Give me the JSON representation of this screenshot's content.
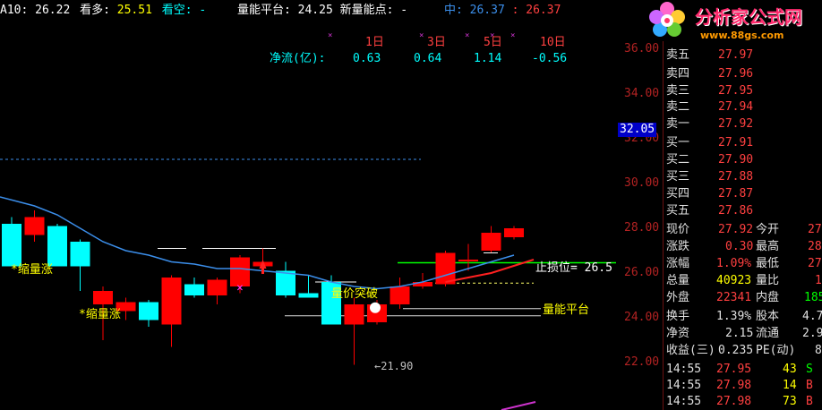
{
  "header": {
    "a10_label": "A10:",
    "a10_value": "26.22",
    "bull_label": "看多:",
    "bull_value": "25.51",
    "bear_label": "看空:",
    "bear_value": "-",
    "vol_platform_label": "量能平台:",
    "vol_platform_value": "24.25",
    "new_vol_label": "新量能点:",
    "new_vol_value": "-",
    "mid_label": "中:",
    "mid_value": "26.37",
    "mid_sep": ":",
    "mid_value2": "26.37"
  },
  "netflow": {
    "label": "净流(亿):",
    "periods": [
      "1日",
      "3日",
      "5日",
      "10日"
    ],
    "values": [
      "0.63",
      "0.64",
      "1.14",
      "-0.56"
    ],
    "marks": [
      "×",
      "×",
      "×",
      "×",
      "×"
    ]
  },
  "logo": {
    "name": "分析家公式网",
    "url": "www.88gs.com"
  },
  "annotations": {
    "shrink_up_1": "*缩量涨",
    "shrink_up_2": "*缩量涨",
    "vol_breakout": "量价突破",
    "stop_loss": "止损位= 26.5",
    "vol_platform": "量能平台",
    "low_price": "←21.90"
  },
  "axis": {
    "ticks": [
      "36.00",
      "34.00",
      "32.00",
      "30.00",
      "28.00",
      "26.00",
      "24.00",
      "22.00"
    ],
    "price_marker": "32.05"
  },
  "chart_data": {
    "type": "candlestick",
    "ylim": [
      21.0,
      37.1
    ],
    "y_ticks": [
      36,
      34,
      32,
      30,
      28,
      26,
      24,
      22
    ],
    "candles": [
      {
        "o": 28.2,
        "h": 28.5,
        "l": 26.3,
        "c": 26.3
      },
      {
        "o": 27.7,
        "h": 28.8,
        "l": 27.4,
        "c": 28.5
      },
      {
        "o": 28.1,
        "h": 28.2,
        "l": 26.3,
        "c": 26.3
      },
      {
        "o": 27.4,
        "h": 27.5,
        "l": 25.2,
        "c": 26.3
      },
      {
        "o": 24.6,
        "h": 25.4,
        "l": 23.0,
        "c": 25.2
      },
      {
        "o": 24.3,
        "h": 24.9,
        "l": 23.9,
        "c": 24.7
      },
      {
        "o": 24.7,
        "h": 24.8,
        "l": 23.6,
        "c": 23.9
      },
      {
        "o": 23.7,
        "h": 25.9,
        "l": 22.7,
        "c": 25.8
      },
      {
        "o": 25.5,
        "h": 25.8,
        "l": 24.9,
        "c": 25.0
      },
      {
        "o": 25.0,
        "h": 25.8,
        "l": 24.6,
        "c": 25.7
      },
      {
        "o": 25.4,
        "h": 26.8,
        "l": 25.1,
        "c": 26.7
      },
      {
        "o": 26.3,
        "h": 27.1,
        "l": 26.1,
        "c": 26.5
      },
      {
        "o": 26.1,
        "h": 26.5,
        "l": 24.9,
        "c": 25.0
      },
      {
        "o": 25.1,
        "h": 25.9,
        "l": 24.9,
        "c": 24.9
      },
      {
        "o": 25.6,
        "h": 25.9,
        "l": 23.7,
        "c": 23.7
      },
      {
        "o": 23.7,
        "h": 24.9,
        "l": 21.9,
        "c": 24.6
      },
      {
        "o": 23.8,
        "h": 24.8,
        "l": 23.7,
        "c": 24.6
      },
      {
        "o": 24.6,
        "h": 25.8,
        "l": 24.4,
        "c": 25.4
      },
      {
        "o": 25.4,
        "h": 26.0,
        "l": 25.3,
        "c": 25.6
      },
      {
        "o": 25.5,
        "h": 27.0,
        "l": 25.4,
        "c": 26.9
      },
      {
        "o": 26.6,
        "h": 27.3,
        "l": 26.1,
        "c": 26.6
      },
      {
        "o": 27.0,
        "h": 28.1,
        "l": 26.9,
        "c": 27.8
      },
      {
        "o": 27.6,
        "h": 28.1,
        "l": 27.5,
        "c": 28.0
      }
    ],
    "ma_line": [
      29.4,
      29.0,
      28.6,
      28.0,
      27.4,
      27.0,
      26.8,
      26.5,
      26.4,
      26.2,
      26.2,
      26.1,
      26.0,
      25.9,
      25.6,
      25.4,
      25.3,
      25.4,
      25.6,
      25.9,
      26.2,
      26.5,
      26.8
    ],
    "levels": {
      "stop_loss": 26.5,
      "vol_platform": 24.25,
      "dotted_top": 32.0
    }
  },
  "quotes": {
    "asks": [
      {
        "label": "卖五",
        "price": "27.97"
      },
      {
        "label": "卖四",
        "price": "27.96"
      },
      {
        "label": "卖三",
        "price": "27.95"
      },
      {
        "label": "卖二",
        "price": "27.94"
      },
      {
        "label": "卖一",
        "price": "27.92"
      }
    ],
    "bids": [
      {
        "label": "买一",
        "price": "27.91"
      },
      {
        "label": "买二",
        "price": "27.90"
      },
      {
        "label": "买三",
        "price": "27.88"
      },
      {
        "label": "买四",
        "price": "27.87"
      },
      {
        "label": "买五",
        "price": "27.86"
      }
    ],
    "stats": [
      {
        "l1": "现价",
        "v1": "27.92",
        "l2": "今开",
        "v2": "27",
        "c1": "#ff4040",
        "c2": "#ff4040"
      },
      {
        "l1": "涨跌",
        "v1": "0.30",
        "l2": "最高",
        "v2": "28",
        "c1": "#ff4040",
        "c2": "#ff4040"
      },
      {
        "l1": "涨幅",
        "v1": "1.09%",
        "l2": "最低",
        "v2": "27",
        "c1": "#ff4040",
        "c2": "#ff4040"
      },
      {
        "l1": "总量",
        "v1": "40923",
        "l2": "量比",
        "v2": "1",
        "c1": "#ffff00",
        "c2": "#ff4040"
      },
      {
        "l1": "外盘",
        "v1": "22341",
        "l2": "内盘",
        "v2": "185",
        "c1": "#ff4040",
        "c2": "#00ff00"
      },
      {
        "l1": "换手",
        "v1": "1.39%",
        "l2": "股本",
        "v2": "4.7",
        "c1": "#e0e0e0",
        "c2": "#e0e0e0"
      },
      {
        "l1": "净资",
        "v1": "2.15",
        "l2": "流通",
        "v2": "2.9",
        "c1": "#e0e0e0",
        "c2": "#e0e0e0"
      },
      {
        "l1": "收益(三)",
        "v1": "0.235",
        "l2": "PE(动)",
        "v2": "8",
        "c1": "#e0e0e0",
        "c2": "#e0e0e0"
      }
    ],
    "ticks": [
      {
        "time": "14:55",
        "price": "27.95",
        "vol": "43",
        "side": "S",
        "vcolor": "#ffff00",
        "scolor": "#00ff00"
      },
      {
        "time": "14:55",
        "price": "27.98",
        "vol": "14",
        "side": "B",
        "vcolor": "#ffff00",
        "scolor": "#ff4040"
      },
      {
        "time": "14:55",
        "price": "27.98",
        "vol": "73",
        "side": "B",
        "vcolor": "#ffff00",
        "scolor": "#ff4040"
      }
    ]
  },
  "colors": {
    "up": "#ff0000",
    "down": "#00ffff",
    "ma": "#3b8eea",
    "stop": "#00ff00",
    "axis_text": "#b22222",
    "label_white": "#ffffff",
    "yellow": "#ffff00",
    "cyan": "#00ffff"
  }
}
